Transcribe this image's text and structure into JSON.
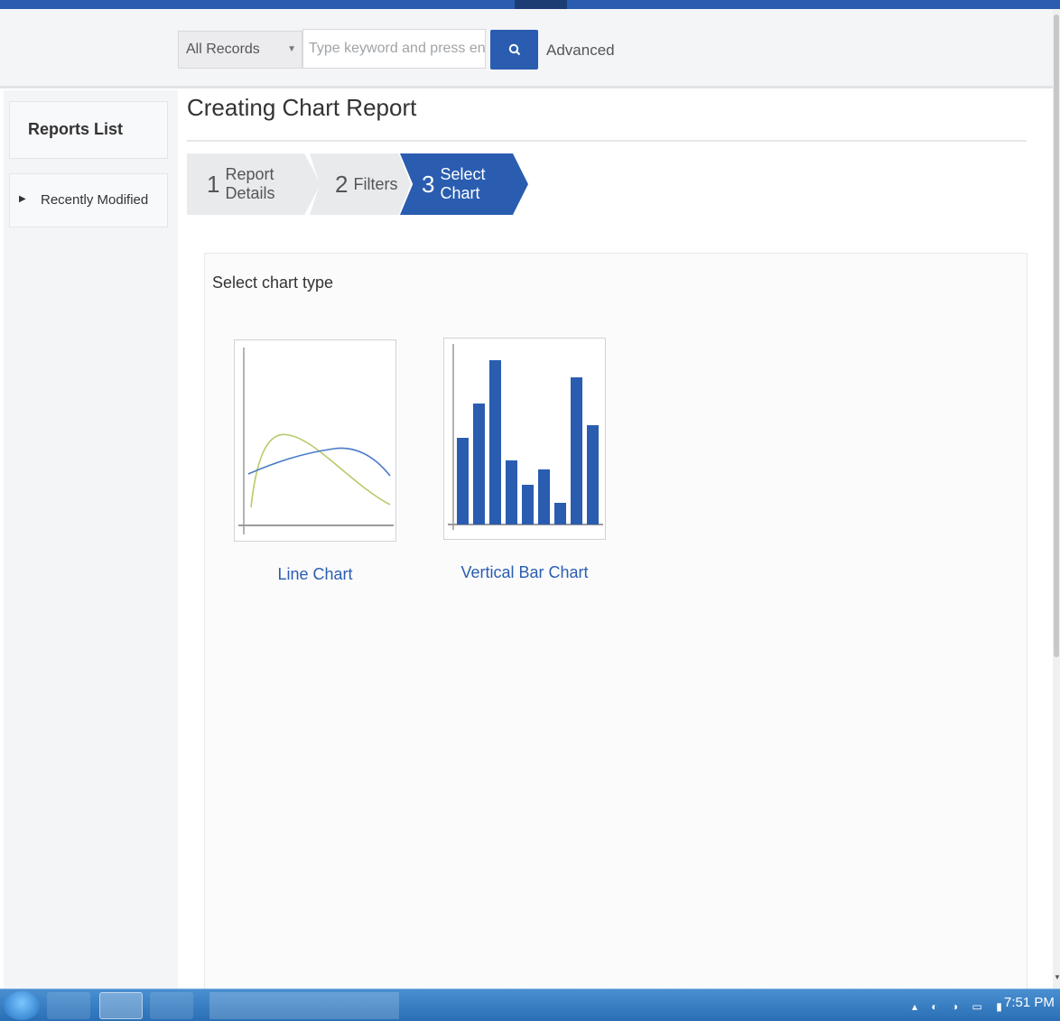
{
  "header": {
    "search_scope": "All Records",
    "search_placeholder": "Type keyword and press enter",
    "advanced_label": "Advanced"
  },
  "sidebar": {
    "title": "Reports List",
    "items": [
      {
        "label": "Recently Modified"
      }
    ]
  },
  "page": {
    "title": "Creating Chart Report",
    "steps": [
      {
        "number": "1",
        "label": "Report Details"
      },
      {
        "number": "2",
        "label": "Filters"
      },
      {
        "number": "3",
        "label": "Select Chart"
      }
    ],
    "active_step": 3,
    "panel_label": "Select chart type",
    "chart_options": [
      {
        "label": "Line Chart",
        "icon": "line-chart-icon"
      },
      {
        "label": "Vertical Bar Chart",
        "icon": "vertical-bar-chart-icon"
      }
    ]
  },
  "taskbar": {
    "clock": "7:51 PM"
  },
  "colors": {
    "accent": "#2a5db0",
    "line_green": "#b5cc6a",
    "line_blue": "#4a7ac8"
  }
}
